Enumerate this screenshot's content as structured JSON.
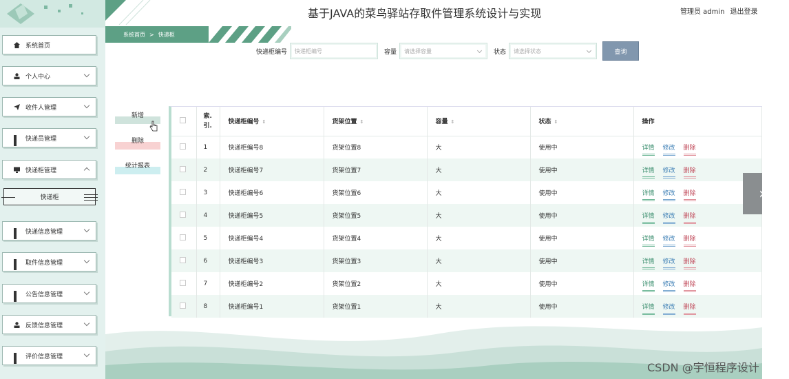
{
  "header": {
    "title": "基于JAVA的菜鸟驿站存取件管理系统设计与实现",
    "user": "管理员 admin",
    "logout": "退出登录"
  },
  "breadcrumb": {
    "home": "系统首页",
    "separator": ">",
    "current": "快递柜"
  },
  "sidebar": {
    "items": [
      {
        "label": "系统首页",
        "icon": "home-icon"
      },
      {
        "label": "个人中心",
        "icon": "user-icon"
      },
      {
        "label": "收件人管理",
        "icon": "send-icon"
      },
      {
        "label": "快递员管理",
        "icon": "grid-icon"
      },
      {
        "label": "快递柜管理",
        "icon": "monitor-icon"
      },
      {
        "label": "快递信息管理",
        "icon": "grid-icon"
      },
      {
        "label": "取件信息管理",
        "icon": "grid-icon"
      },
      {
        "label": "公告信息管理",
        "icon": "grid-icon"
      },
      {
        "label": "反馈信息管理",
        "icon": "user-icon"
      },
      {
        "label": "评价信息管理",
        "icon": "grid-icon"
      }
    ],
    "submenu": "快递柜"
  },
  "search": {
    "f1_label": "快递柜编号",
    "f1_placeholder": "快递柜编号",
    "f2_label": "容量",
    "f2_placeholder": "请选择容量",
    "f3_label": "状态",
    "f3_placeholder": "请选择状态",
    "button": "查询"
  },
  "actions": {
    "add": "新增",
    "delete": "删除",
    "stats": "统计报表"
  },
  "table": {
    "headers": [
      "索引",
      "快递柜编号",
      "货架位置",
      "容量",
      "状态",
      "操作"
    ],
    "index_header_l1": "索.",
    "index_header_l2": "引.",
    "rows": [
      {
        "idx": "1",
        "code": "快递柜编号8",
        "pos": "货架位置8",
        "cap": "大",
        "status": "使用中"
      },
      {
        "idx": "2",
        "code": "快递柜编号7",
        "pos": "货架位置7",
        "cap": "大",
        "status": "使用中"
      },
      {
        "idx": "3",
        "code": "快递柜编号6",
        "pos": "货架位置6",
        "cap": "大",
        "status": "使用中"
      },
      {
        "idx": "4",
        "code": "快递柜编号5",
        "pos": "货架位置5",
        "cap": "大",
        "status": "使用中"
      },
      {
        "idx": "5",
        "code": "快递柜编号4",
        "pos": "货架位置4",
        "cap": "大",
        "status": "使用中"
      },
      {
        "idx": "6",
        "code": "快递柜编号3",
        "pos": "货架位置3",
        "cap": "大",
        "status": "使用中"
      },
      {
        "idx": "7",
        "code": "快递柜编号2",
        "pos": "货架位置2",
        "cap": "大",
        "status": "使用中"
      },
      {
        "idx": "8",
        "code": "快递柜编号1",
        "pos": "货架位置1",
        "cap": "大",
        "status": "使用中"
      }
    ],
    "op_detail": "详情",
    "op_edit": "修改",
    "op_delete": "删除"
  },
  "watermark": "CSDN @宇恒程序设计",
  "colors": {
    "accent": "#5da085",
    "search_button": "#8197ae",
    "sidebar_bg": "#e3f1ee"
  }
}
